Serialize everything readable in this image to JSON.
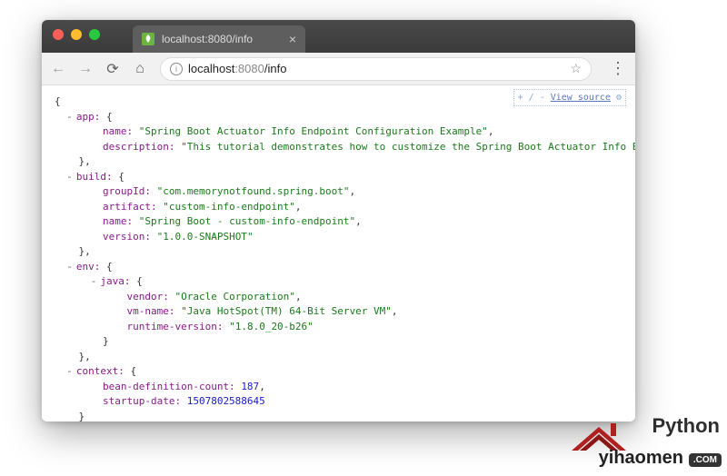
{
  "browser": {
    "tab_title": "localhost:8080/info",
    "url_host": "localhost",
    "url_port": ":8080",
    "url_path": "/info",
    "view_source_label": "View source",
    "view_source_plus": "+ / -",
    "view_source_gear": "⚙"
  },
  "json": {
    "app": {
      "name": "Spring Boot Actuator Info Endpoint Configuration Example",
      "description": "This tutorial demonstrates how to customize the Spring Boot Actuator Info Endpoint."
    },
    "build": {
      "groupId": "com.memorynotfound.spring.boot",
      "artifact": "custom-info-endpoint",
      "name": "Spring Boot - custom-info-endpoint",
      "version": "1.0.0-SNAPSHOT"
    },
    "env": {
      "java": {
        "vendor": "Oracle Corporation",
        "vm-name": "Java HotSpot(TM) 64-Bit Server VM",
        "runtime-version": "1.8.0_20-b26"
      }
    },
    "context": {
      "bean-definition-count": 187,
      "startup-date": 1507802588645
    }
  },
  "keys": {
    "app": "app:",
    "app_name": "name:",
    "app_description": "description:",
    "build": "build:",
    "build_groupId": "groupId:",
    "build_artifact": "artifact:",
    "build_name": "name:",
    "build_version": "version:",
    "env": "env:",
    "env_java": "java:",
    "env_vendor": "vendor:",
    "env_vmname": "vm-name:",
    "env_runtime": "runtime-version:",
    "context": "context:",
    "context_bdc": "bean-definition-count:",
    "context_sd": "startup-date:"
  },
  "watermark": {
    "line1": "Python",
    "line2": "yihaomen",
    "com": ".COM"
  }
}
